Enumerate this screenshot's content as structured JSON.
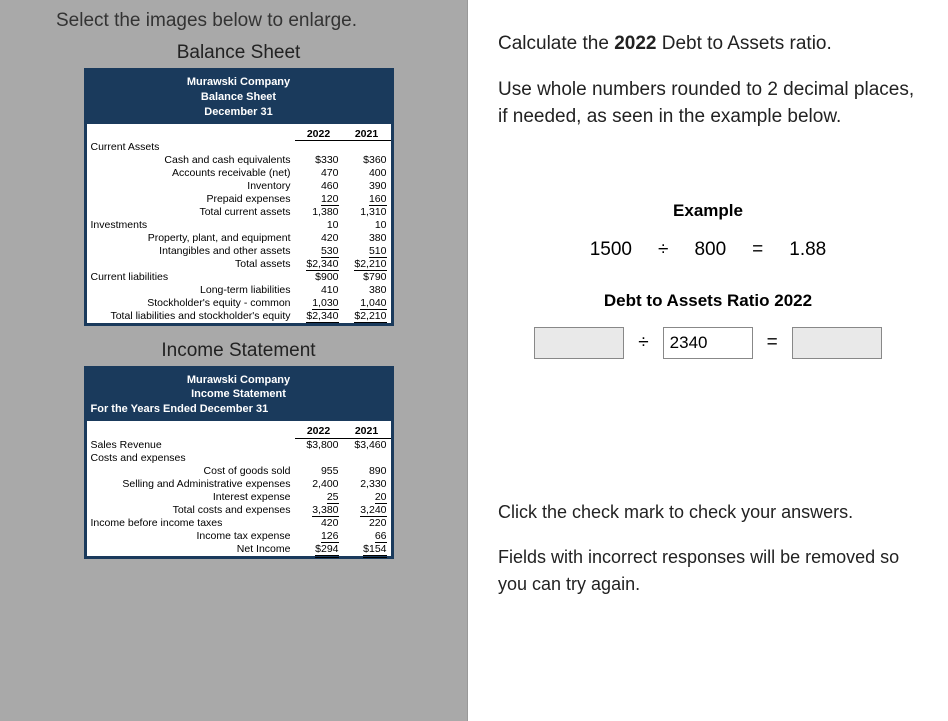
{
  "left": {
    "enlarge": "Select the images below to enlarge.",
    "balance_title": "Balance Sheet",
    "balance_header": {
      "l1": "Murawski Company",
      "l2": "Balance Sheet",
      "l3": "December 31"
    },
    "years": {
      "y1": "2022",
      "y2": "2021"
    },
    "bs": {
      "ca_head": "Current Assets",
      "cash": "Cash and cash equivalents",
      "cash_22": "$330",
      "cash_21": "$360",
      "ar": "Accounts receivable (net)",
      "ar_22": "470",
      "ar_21": "400",
      "inv": "Inventory",
      "inv_22": "460",
      "inv_21": "390",
      "pre": "Prepaid expenses",
      "pre_22": "120",
      "pre_21": "160",
      "tca": "Total current assets",
      "tca_22": "1,380",
      "tca_21": "1,310",
      "invst": "Investments",
      "invst_22": "10",
      "invst_21": "10",
      "ppe": "Property, plant, and equipment",
      "ppe_22": "420",
      "ppe_21": "380",
      "intang": "Intangibles and other assets",
      "intang_22": "530",
      "intang_21": "510",
      "ta": "Total assets",
      "ta_22": "$2,340",
      "ta_21": "$2,210",
      "cl": "Current liabilities",
      "cl_22": "$900",
      "cl_21": "$790",
      "ltl": "Long-term liabilities",
      "ltl_22": "410",
      "ltl_21": "380",
      "se": "Stockholder's equity - common",
      "se_22": "1,030",
      "se_21": "1,040",
      "tle": "Total liabilities and stockholder's equity",
      "tle_22": "$2,340",
      "tle_21": "$2,210"
    },
    "income_title": "Income Statement",
    "income_header": {
      "l1": "Murawski Company",
      "l2": "Income Statement",
      "l3": "For the Years Ended December 31"
    },
    "is": {
      "rev": "Sales Revenue",
      "rev_22": "$3,800",
      "rev_21": "$3,460",
      "ce_head": "Costs and expenses",
      "cogs": "Cost of goods sold",
      "cogs_22": "955",
      "cogs_21": "890",
      "sga": "Selling and Administrative expenses",
      "sga_22": "2,400",
      "sga_21": "2,330",
      "int": "Interest expense",
      "int_22": "25",
      "int_21": "20",
      "tce": "Total costs and expenses",
      "tce_22": "3,380",
      "tce_21": "3,240",
      "ibt": "Income before income taxes",
      "ibt_22": "420",
      "ibt_21": "220",
      "tax": "Income tax expense",
      "tax_22": "126",
      "tax_21": "66",
      "ni": "Net Income",
      "ni_22": "$294",
      "ni_21": "$154"
    }
  },
  "right": {
    "q1a": "Calculate the ",
    "q1b": "2022",
    "q1c": " Debt to Assets ratio.",
    "q2": "Use whole numbers rounded to 2 decimal places, if needed, as seen in the example below.",
    "example": "Example",
    "ex_n": "1500",
    "ex_div": "÷",
    "ex_d": "800",
    "ex_eq": "=",
    "ex_r": "1.88",
    "ratio_title": "Debt to Assets Ratio 2022",
    "input1": "",
    "input2": "2340",
    "input3": "",
    "bottom1": "Click the check mark to check your answers.",
    "bottom2": "Fields with incorrect responses will be removed so you can try again."
  }
}
